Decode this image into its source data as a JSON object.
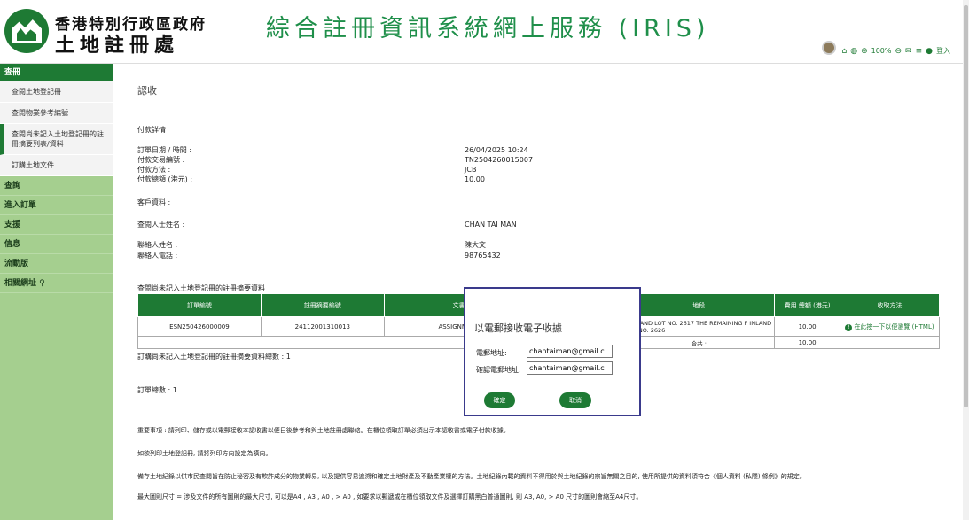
{
  "header": {
    "dept_line1": "香港特別行政區政府",
    "dept_line2": "土地註冊處",
    "system_title": "綜合註冊資訊系統網上服務 (IRIS)",
    "zoom": "100%",
    "login": "登入",
    "icons": [
      "home-icon",
      "globe-icon",
      "zoom-in-icon",
      "zoom-out-icon",
      "mail-icon",
      "user-icon"
    ]
  },
  "sidebar": {
    "section": "查冊",
    "sub_items": [
      "查閱土地登記冊",
      "查閱物業參考編號",
      "查閱尚未記入土地登記冊的註冊摘要列表/資料",
      "訂購土地文件"
    ],
    "items": [
      "查詢",
      "進入訂單",
      "支援",
      "信息",
      "流動版",
      "相關網址"
    ]
  },
  "main": {
    "page_title": "認收",
    "payment_heading": "付款詳情",
    "payment": [
      {
        "label": "訂單日期 / 時間 :",
        "value": "26/04/2025 10:24"
      },
      {
        "label": "付款交易編號 :",
        "value": "TN2504260015007"
      },
      {
        "label": "付款方法 :",
        "value": "JCB"
      },
      {
        "label": "付款總額 (港元) :",
        "value": "10.00"
      }
    ],
    "customer_heading": "客戶資料 :",
    "searcher_label": "查閱人士姓名 :",
    "searcher_value": "CHAN TAI MAN",
    "contact_name_label": "聯絡人姓名 :",
    "contact_name_value": "陳大文",
    "contact_phone_label": "聯絡人電話 :",
    "contact_phone_value": "98765432",
    "table_title": "查閱尚未記入土地登記冊的註冊摘要資料",
    "table_headers": [
      "訂單編號",
      "註冊摘要編號",
      "文書",
      "",
      "地段",
      "費用 總額 (港元)",
      "收取方法"
    ],
    "row": {
      "order_no": "ESN250426000009",
      "memorial_no": "24112001310013",
      "instrument": "ASSIGNMENT",
      "lot": "F INLAND LOT NO. 2617 THE REMAINING F INLAND LOT NO. 2626",
      "fee": "10.00",
      "method": "在此按一下以便瀏覽 (HTML)"
    },
    "total_label": "合共 :",
    "total_value": "10.00",
    "ordered_count": "訂購尚未記入土地登記冊的註冊摘要資料總數 : 1",
    "order_total": "訂單總數 : 1",
    "notes": [
      "重要事項 : 請列印、儲存或以電郵接收本認收書以便日後參考和與土地註冊處聯絡。在櫃位領取訂單必須出示本認收書或電子付款收據。",
      "如欲列印土地登記冊, 請將列印方向設定為橫向。",
      "備存土地紀錄以供市民查閱旨在防止秘密及有欺詐成分的物業轉易, 以及提供容易追溯和確定土地財產及不動產業權的方法。土地紀錄內載的資料不得用於與土地紀錄的宗旨無關之目的, 使用所提供的資料須符合《個人資料 (私隱) 條例》的規定。",
      "最大圖則尺寸 = 涉及文件的所有圖則的最大尺寸, 可以是A4 , A3 , A0 , > A0 , 如要求以郵遞或在櫃位領取文件及選擇訂購黑白普通圖則, 則 A3, A0, > A0 尺寸的圖則會縮至A4尺寸。"
    ]
  },
  "dialog": {
    "title": "以電郵接收電子收據",
    "email_label": "電郵地址:",
    "email_value": "chantaiman@gmail.c",
    "confirm_label": "確認電郵地址:",
    "confirm_value": "chantaiman@gmail.c",
    "ok_button": "確定",
    "cancel_button": "取消"
  }
}
